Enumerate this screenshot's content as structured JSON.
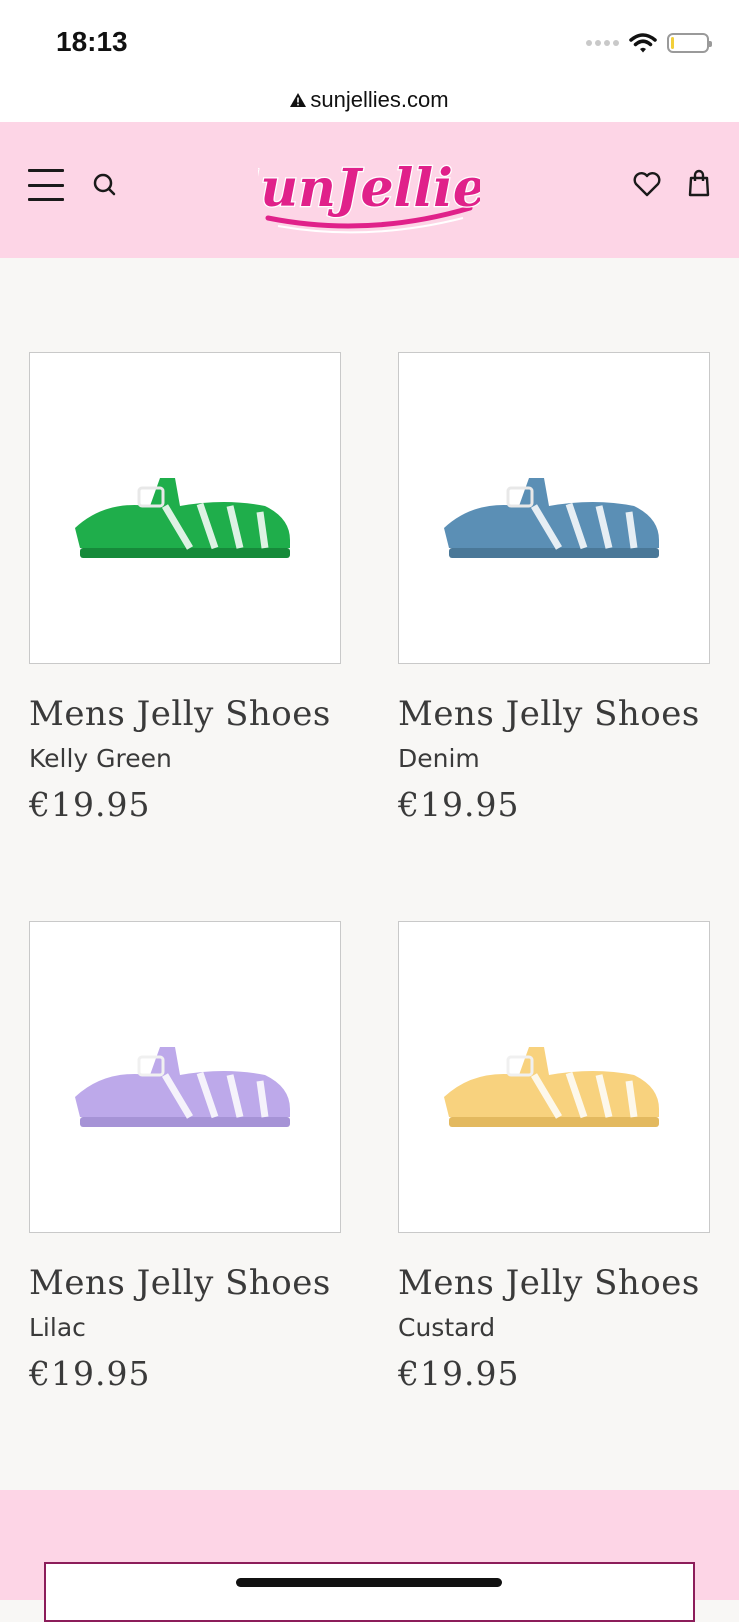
{
  "status_bar": {
    "time": "18:13"
  },
  "browser": {
    "url": "sunjellies.com"
  },
  "header": {
    "logo_text": "SunJellies",
    "accent_color": "#e0218a",
    "background_color": "#fdd5e6"
  },
  "products": [
    {
      "title": "Mens Jelly Shoes",
      "variant": "Kelly Green",
      "price": "€19.95",
      "color": "#1fae4b"
    },
    {
      "title": "Mens Jelly Shoes",
      "variant": "Denim",
      "price": "€19.95",
      "color": "#5b8fb5"
    },
    {
      "title": "Mens Jelly Shoes",
      "variant": "Lilac",
      "price": "€19.95",
      "color": "#bda9ea"
    },
    {
      "title": "Mens Jelly Shoes",
      "variant": "Custard",
      "price": "€19.95",
      "color": "#f8d27e"
    }
  ]
}
